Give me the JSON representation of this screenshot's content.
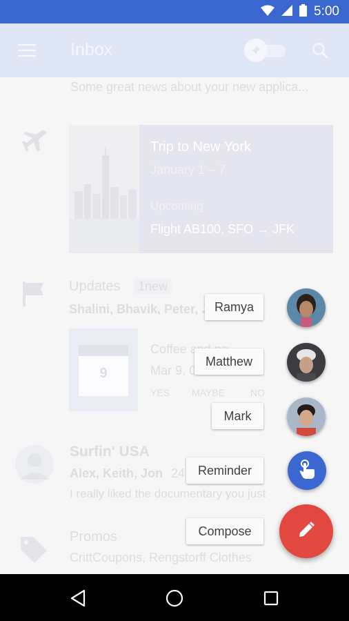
{
  "status_bar": {
    "time": "5:00"
  },
  "app_bar": {
    "title": "Inbox"
  },
  "inbox": {
    "preview_snippet": "Some great news about your new applica...",
    "trip": {
      "title": "Trip to New York",
      "dates": "January 1 – 7",
      "status": "Upcoming",
      "flight": "Flight AB100,  SFO → JFK"
    },
    "updates": {
      "title": "Updates",
      "badge": "1new",
      "senders": "Shalini, Bhavik, Peter, J",
      "event_title": "Coffee and ne",
      "event_time": "Mar 9,                00",
      "calendar_day": "9",
      "rsvp": [
        "YES",
        "MAYBE",
        "NO"
      ]
    },
    "surfin": {
      "title": "Surfin' USA",
      "senders": "Alex, Keith, Jon",
      "count": "24",
      "snippet": "I really liked the documentary you just"
    },
    "promos": {
      "title": "Promos",
      "senders": "CrittCoupons, Rengstorff Clothes"
    }
  },
  "speed_dial": {
    "contacts": [
      "Ramya",
      "Matthew",
      "Mark"
    ],
    "reminder_label": "Reminder",
    "compose_label": "Compose"
  },
  "colors": {
    "status_bar": "#3a66d0",
    "reminder_fab": "#3b67d1",
    "compose_fab": "#e2483f"
  },
  "icons": {
    "menu": "menu-icon",
    "pin": "pin-icon",
    "search": "search-icon",
    "trip": "airplane-icon",
    "updates": "flag-icon",
    "promos": "tag-icon",
    "reminder": "hand-pointer-icon",
    "compose": "pencil-icon",
    "nav": [
      "back-icon",
      "home-icon",
      "recents-icon"
    ]
  }
}
